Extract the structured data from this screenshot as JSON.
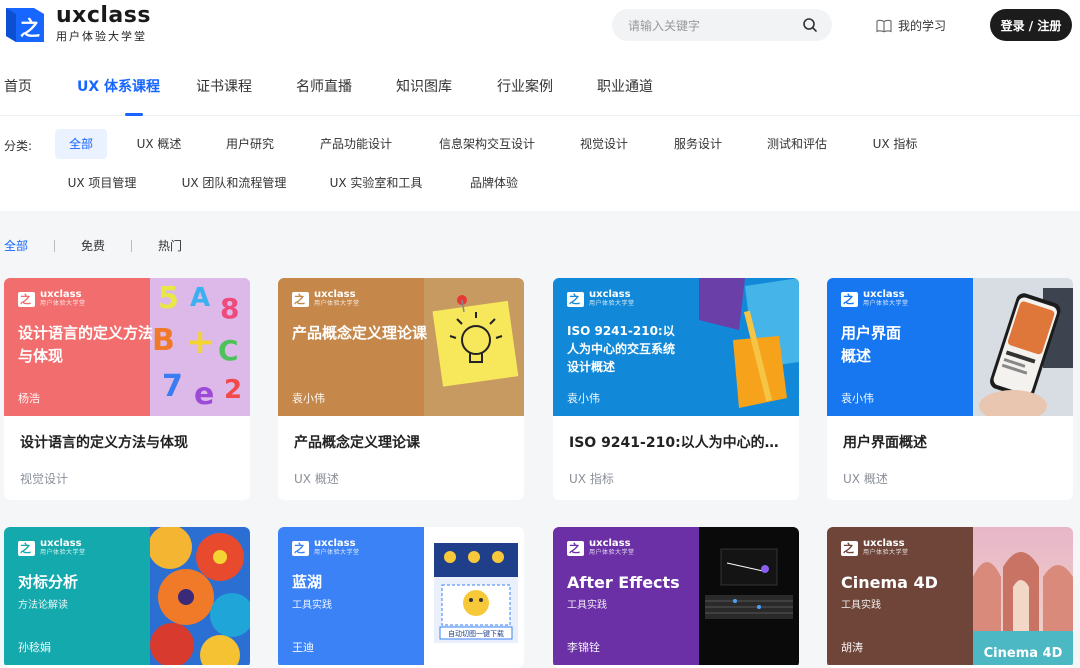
{
  "logo": {
    "name": "uxclass",
    "tagline": "用户体验大学堂",
    "mark_glyph": "之"
  },
  "search": {
    "placeholder": "请输入关键字",
    "icon": "search-icon"
  },
  "my_learning": {
    "label": "我的学习",
    "icon": "book-icon"
  },
  "login": {
    "label": "登录 / 注册"
  },
  "nav": {
    "items": [
      {
        "label": "首页",
        "active": false
      },
      {
        "label": "UX 体系课程",
        "active": true
      },
      {
        "label": "证书课程",
        "active": false
      },
      {
        "label": "名师直播",
        "active": false
      },
      {
        "label": "知识图库",
        "active": false
      },
      {
        "label": "行业案例",
        "active": false
      },
      {
        "label": "职业通道",
        "active": false
      }
    ],
    "active_color": "#1766ff"
  },
  "categories": {
    "label": "分类:",
    "items": [
      {
        "label": "全部",
        "active": true
      },
      {
        "label": "UX 概述"
      },
      {
        "label": "用户研究"
      },
      {
        "label": "产品功能设计"
      },
      {
        "label": "信息架构交互设计"
      },
      {
        "label": "视觉设计"
      },
      {
        "label": "服务设计"
      },
      {
        "label": "测试和评估"
      },
      {
        "label": "UX 指标"
      },
      {
        "label": "UX 项目管理"
      },
      {
        "label": "UX 团队和流程管理"
      },
      {
        "label": "UX 实验室和工具"
      },
      {
        "label": "品牌体验"
      }
    ]
  },
  "filter_tabs": [
    {
      "label": "全部",
      "active": true
    },
    {
      "label": "免费"
    },
    {
      "label": "热门"
    }
  ],
  "cover_brand": {
    "name": "uxclass",
    "tagline": "用户体验大学堂"
  },
  "courses": [
    {
      "cover_title": "设计语言的定义方法与体现",
      "cover_sub": "",
      "author": "杨浩",
      "title": "设计语言的定义方法与体现",
      "category": "视觉设计",
      "color": "#f26d6d",
      "art": "alphabet"
    },
    {
      "cover_title": "产品概念定义理论课",
      "cover_sub": "",
      "author": "袁小伟",
      "title": "产品概念定义理论课",
      "category": "UX 概述",
      "color": "#c5874a",
      "art": "bulb"
    },
    {
      "cover_title": "ISO 9241-210:以人为中心的交互系统设计概述",
      "cover_sub": "",
      "author": "袁小伟",
      "title": "ISO 9241-210:以人为中心的交...",
      "category": "UX 指标",
      "color": "#1289d8",
      "art": "paper"
    },
    {
      "cover_title": "用户界面概述",
      "cover_sub": "",
      "author": "袁小伟",
      "title": "用户界面概述",
      "category": "UX 概述",
      "color": "#1677f0",
      "art": "phone"
    },
    {
      "cover_title": "对标分析",
      "cover_sub": "方法论解读",
      "author": "孙稔娟",
      "title": "",
      "category": "",
      "color": "#14a9ad",
      "art": "flower"
    },
    {
      "cover_title": "蓝湖",
      "cover_sub": "工具实践",
      "author": "王迪",
      "title": "",
      "category": "",
      "color": "#3b82f6",
      "art": "lanhu",
      "art_caption": "自动切图一键下载"
    },
    {
      "cover_title": "After Effects",
      "cover_sub": "工具实践",
      "author": "李锦铨",
      "title": "",
      "category": "",
      "color": "#6b2fa6",
      "art": "ae"
    },
    {
      "cover_title": "Cinema 4D",
      "cover_sub": "工具实践",
      "author": "胡涛",
      "title": "",
      "category": "",
      "color": "#6e4538",
      "art": "c4d",
      "art_caption": "Cinema 4D"
    }
  ]
}
